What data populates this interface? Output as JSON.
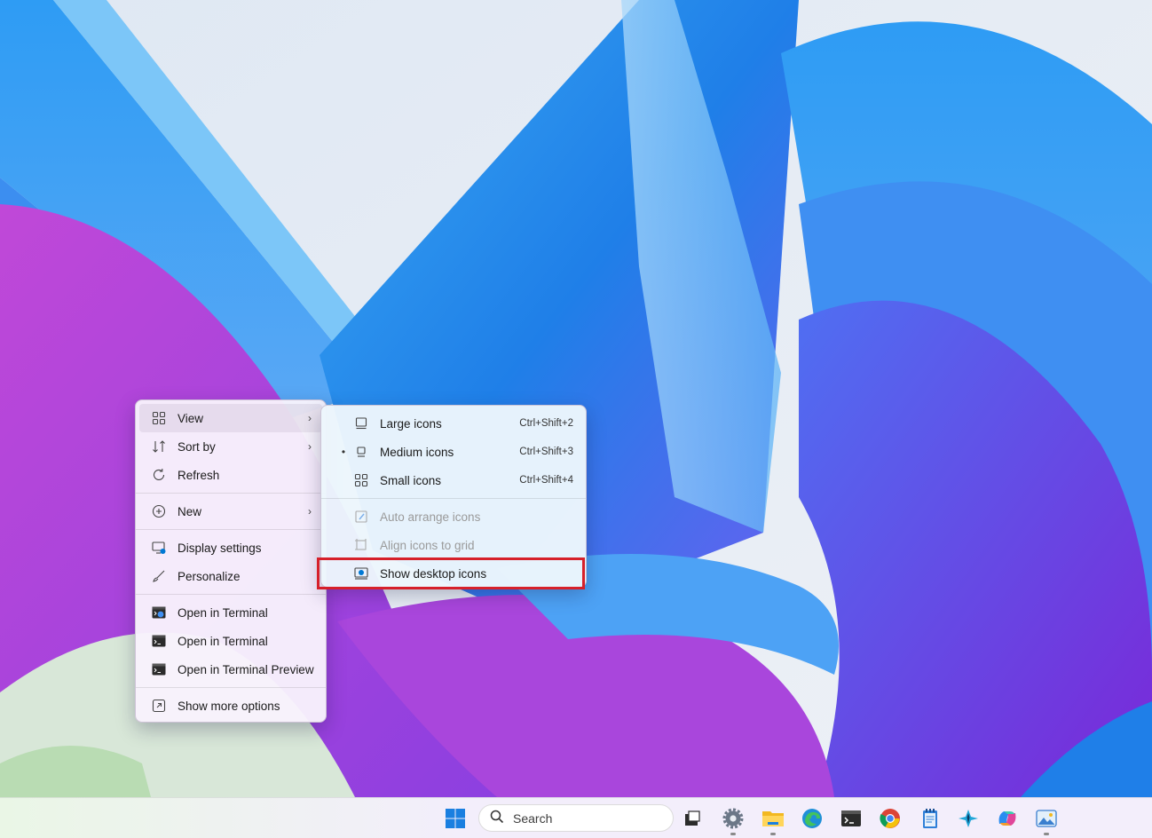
{
  "main_menu": {
    "items": [
      {
        "label": "View"
      },
      {
        "label": "Sort by"
      },
      {
        "label": "Refresh"
      },
      {
        "label": "New"
      },
      {
        "label": "Display settings"
      },
      {
        "label": "Personalize"
      },
      {
        "label": "Open in Terminal"
      },
      {
        "label": "Open in Terminal"
      },
      {
        "label": "Open in Terminal Preview"
      },
      {
        "label": "Show more options"
      }
    ]
  },
  "view_submenu": {
    "items": [
      {
        "label": "Large icons",
        "shortcut": "Ctrl+Shift+2"
      },
      {
        "label": "Medium icons",
        "shortcut": "Ctrl+Shift+3",
        "bullet": "•"
      },
      {
        "label": "Small icons",
        "shortcut": "Ctrl+Shift+4"
      },
      {
        "label": "Auto arrange icons"
      },
      {
        "label": "Align icons to grid"
      },
      {
        "label": "Show desktop icons"
      }
    ]
  },
  "taskbar": {
    "search_placeholder": "Search",
    "apps": [
      "windows-start-icon",
      "task-view-icon",
      "settings-icon",
      "file-explorer-icon",
      "edge-icon",
      "terminal-icon",
      "chrome-icon",
      "notepad-icon",
      "copilot-dev-icon",
      "copilot-icon",
      "photos-icon"
    ]
  },
  "colors": {
    "highlight_border": "#d6202a",
    "accent": "#0078d4"
  }
}
